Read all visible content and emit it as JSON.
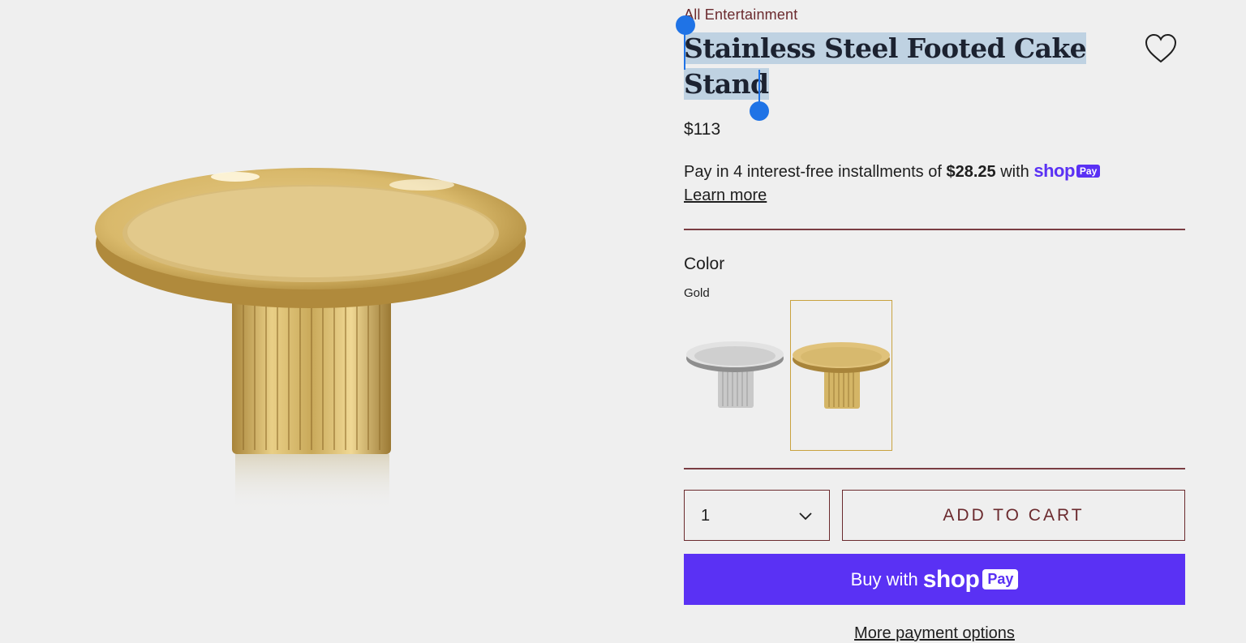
{
  "breadcrumb": "All Entertainment",
  "product": {
    "title_line1": "Stainless Steel Footed Cake",
    "title_line2": "Stand",
    "price": "$113"
  },
  "installments": {
    "prefix": "Pay in 4 interest-free installments of",
    "amount": "$28.25",
    "with": "with",
    "shop_word": "shop",
    "pay_badge": "Pay",
    "learn_more": "Learn more"
  },
  "color": {
    "label": "Color",
    "selected": "Gold",
    "swatches": [
      {
        "name": "Silver",
        "selected": false
      },
      {
        "name": "Gold",
        "selected": true
      }
    ]
  },
  "quantity": {
    "value": "1"
  },
  "buttons": {
    "add_to_cart": "ADD TO CART",
    "buy_with": "Buy with",
    "shop_word": "shop",
    "pay_badge": "Pay",
    "more_options": "More payment options"
  },
  "icons": {
    "wishlist": "heart-outline-icon",
    "qty_dropdown": "chevron-down-icon"
  },
  "colors": {
    "background": "#efefef",
    "accent_maroon": "#6b2a2e",
    "shop_purple": "#5a31f4",
    "selection": "#bfd2e2",
    "selection_handle": "#1f73e6",
    "gold_border": "#c9a23f"
  }
}
